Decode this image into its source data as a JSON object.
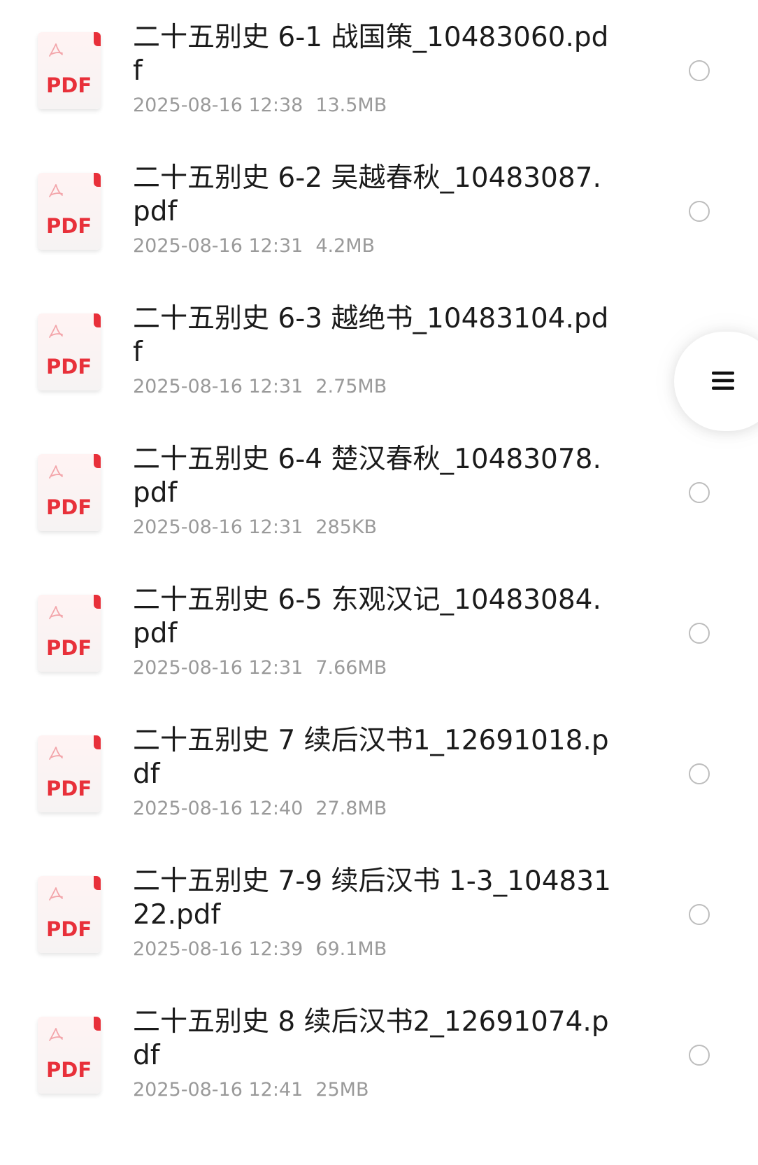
{
  "files": [
    {
      "name": "二十五别史 6-1 战国策_10483060.pdf",
      "date": "2025-08-16 12:38",
      "size": "13.5MB",
      "icon": "pdf-file-icon",
      "icon_label": "PDF"
    },
    {
      "name": "二十五别史 6-2 吴越春秋_10483087.pdf",
      "date": "2025-08-16 12:31",
      "size": "4.2MB",
      "icon": "pdf-file-icon",
      "icon_label": "PDF"
    },
    {
      "name": "二十五别史 6-3 越绝书_10483104.pdf",
      "date": "2025-08-16 12:31",
      "size": "2.75MB",
      "icon": "pdf-file-icon",
      "icon_label": "PDF"
    },
    {
      "name": "二十五别史 6-4 楚汉春秋_10483078.pdf",
      "date": "2025-08-16 12:31",
      "size": "285KB",
      "icon": "pdf-file-icon",
      "icon_label": "PDF"
    },
    {
      "name": "二十五别史 6-5 东观汉记_10483084.pdf",
      "date": "2025-08-16 12:31",
      "size": "7.66MB",
      "icon": "pdf-file-icon",
      "icon_label": "PDF"
    },
    {
      "name": "二十五别史 7 续后汉书1_12691018.pdf",
      "date": "2025-08-16 12:40",
      "size": "27.8MB",
      "icon": "pdf-file-icon",
      "icon_label": "PDF"
    },
    {
      "name": "二十五别史 7-9 续后汉书 1-3_10483122.pdf",
      "date": "2025-08-16 12:39",
      "size": "69.1MB",
      "icon": "pdf-file-icon",
      "icon_label": "PDF"
    },
    {
      "name": "二十五别史 8 续后汉书2_12691074.pdf",
      "date": "2025-08-16 12:41",
      "size": "25MB",
      "icon": "pdf-file-icon",
      "icon_label": "PDF"
    }
  ],
  "floating_menu": {
    "icon": "menu-icon"
  },
  "colors": {
    "pdf_accent": "#e8303a",
    "title_text": "#1b1b1b",
    "meta_text": "#9a9a9a",
    "radio_border": "#bdbdbd"
  }
}
